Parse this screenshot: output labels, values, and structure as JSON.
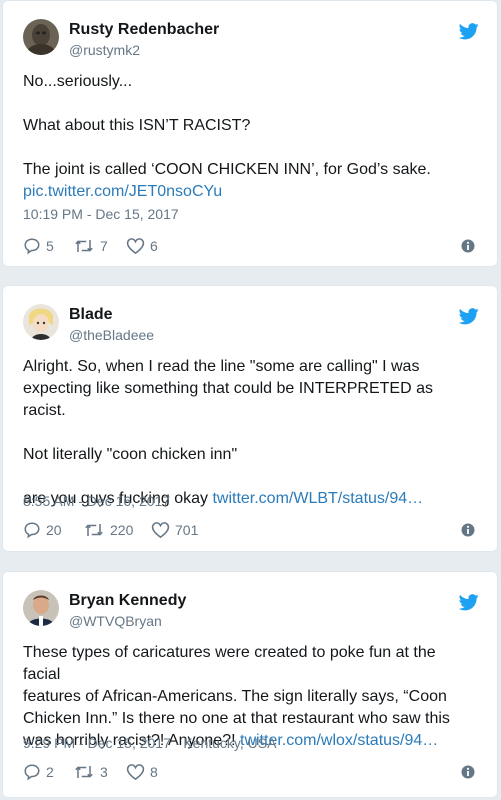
{
  "tweets": [
    {
      "name": "Rusty Redenbacher",
      "handle": "@rustymk2",
      "lines": [
        "No...seriously...",
        "",
        "What about this ISN’T RACIST?",
        "",
        "The joint is called ‘COON CHICKEN INN’, for God’s sake."
      ],
      "link": "pic.twitter.com/JET0nsoCYu",
      "timestamp": "10:19 PM - Dec 15, 2017",
      "location": "",
      "replies": "5",
      "retweets": "7",
      "likes": "6"
    },
    {
      "name": "Blade",
      "handle": "@theBladeee",
      "lines": [
        "Alright. So, when I read the line \"some are calling\" I was",
        "expecting like something that could be INTERPRETED as racist.",
        "",
        "Not literally \"coon chicken inn\"",
        ""
      ],
      "last_line_prefix": "are you guys fucking okay ",
      "link": "twitter.com/WLBT/status/94…",
      "timestamp": "8:55 AM - Dec 16, 2017",
      "location": "",
      "replies": "20",
      "retweets": "220",
      "likes": "701"
    },
    {
      "name": "Bryan Kennedy",
      "handle": "@WTVQBryan",
      "lines": [
        "These types of caricatures were created to poke fun at the facial",
        "features of African-Americans. The sign literally says, “Coon",
        "Chicken Inn.” Is there no one at that restaurant who saw this"
      ],
      "last_line_prefix": "was horribly racist?! Anyone?! ",
      "link": "twitter.com/wlox/status/94…",
      "timestamp": "9:29 PM - Dec 15, 2017",
      "location": " · Kentucky, USA",
      "replies": "2",
      "retweets": "3",
      "likes": "8"
    }
  ],
  "colors": {
    "background": "#e6ecf0",
    "card": "#ffffff",
    "link": "#2b7bb9",
    "secondary_text": "#657786",
    "twitter_blue": "#1da1f2"
  },
  "icons": [
    "avatar",
    "twitter-bird-icon",
    "reply-icon",
    "retweet-icon",
    "like-icon",
    "info-icon"
  ]
}
